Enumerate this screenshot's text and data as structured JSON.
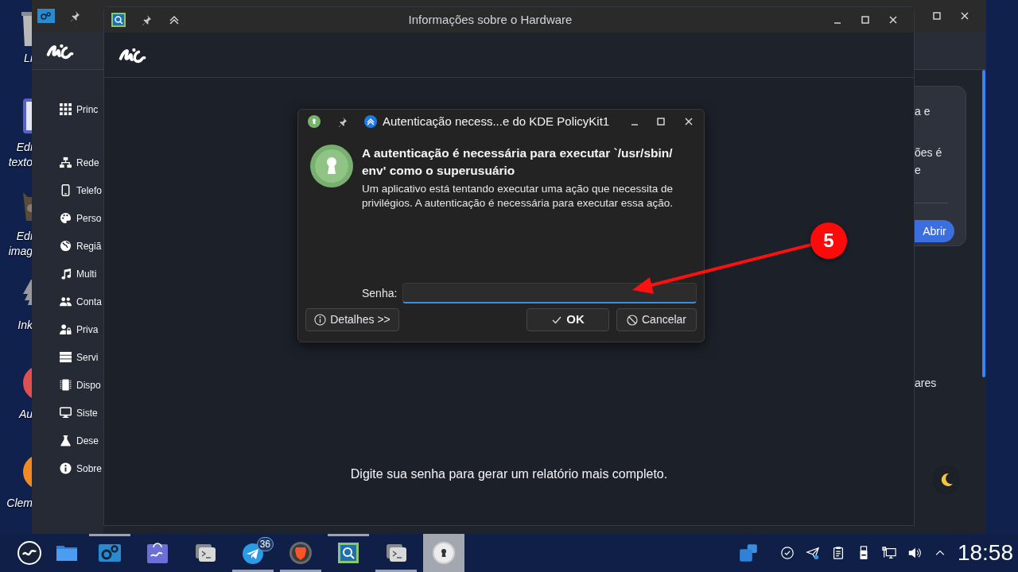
{
  "desktop_icons": [
    {
      "kind": "trash",
      "lines": [
        "Li"
      ]
    },
    {
      "kind": "document",
      "lines": [
        "Edi",
        "texto"
      ]
    },
    {
      "kind": "image-editor",
      "lines": [
        "Edi",
        "imag"
      ]
    },
    {
      "kind": "vector",
      "lines": [
        "Ink"
      ]
    },
    {
      "kind": "audio",
      "lines": [
        "Au"
      ]
    },
    {
      "kind": "music",
      "lines": [
        "Clem"
      ]
    }
  ],
  "settings_window": {
    "sidebar": [
      {
        "kind": "grid",
        "label": "Princ"
      },
      {
        "kind": "network",
        "label": "Rede"
      },
      {
        "kind": "phone",
        "label": "Telefo"
      },
      {
        "kind": "palette",
        "label": "Perso"
      },
      {
        "kind": "globe",
        "label": "Regiã"
      },
      {
        "kind": "music",
        "label": "Multi"
      },
      {
        "kind": "users",
        "label": "Conta"
      },
      {
        "kind": "privacy",
        "label": "Priva"
      },
      {
        "kind": "server",
        "label": "Servi"
      },
      {
        "kind": "chip",
        "label": "Dispo"
      },
      {
        "kind": "monitor",
        "label": "Siste"
      },
      {
        "kind": "flask",
        "label": "Dese"
      },
      {
        "kind": "info",
        "label": "Sobre"
      }
    ],
    "card_lines": [
      "a e",
      "ões é",
      "e"
    ],
    "card_button": "Abrir",
    "footer_text": "ares"
  },
  "hardware_window": {
    "title": "Informações sobre o Hardware",
    "message": "Digite sua senha para gerar um relatório mais completo."
  },
  "auth_dialog": {
    "title": "Autenticação necess...e do KDE PolicyKit1",
    "heading_lines": [
      "A autenticação é necessária para executar `/usr/sbin/",
      "env' como o superusuário"
    ],
    "description": "Um aplicativo está tentando executar uma ação que necessita de privilégios. A autenticação é necessária para executar essa ação.",
    "password_label": "Senha:",
    "details_button": "Detalhes >>",
    "ok_button": "OK",
    "cancel_button": "Cancelar"
  },
  "annotation": {
    "label": "5"
  },
  "taskbar": {
    "apps": [
      {
        "kind": "start",
        "line_above": false,
        "line_below": false,
        "selected": false
      },
      {
        "kind": "files",
        "line_above": false,
        "line_below": false,
        "selected": false
      },
      {
        "kind": "settings",
        "line_above": true,
        "line_below": false,
        "selected": false
      },
      {
        "kind": "store",
        "line_above": false,
        "line_below": false,
        "selected": false
      },
      {
        "kind": "terminal",
        "line_above": false,
        "line_below": false,
        "selected": false
      },
      {
        "kind": "telegram",
        "line_above": false,
        "line_below": true,
        "selected": false,
        "badge": "36"
      },
      {
        "kind": "browser",
        "line_above": false,
        "line_below": true,
        "selected": false
      },
      {
        "kind": "hardware",
        "line_above": true,
        "line_below": false,
        "selected": false
      },
      {
        "kind": "terminal",
        "line_above": false,
        "line_below": true,
        "selected": false
      },
      {
        "kind": "auth",
        "line_above": false,
        "line_below": false,
        "selected": true
      }
    ],
    "tray": [
      {
        "kind": "windows"
      },
      {
        "kind": "check"
      },
      {
        "kind": "send"
      },
      {
        "kind": "clipboard"
      },
      {
        "kind": "usb"
      },
      {
        "kind": "wired"
      },
      {
        "kind": "volume"
      },
      {
        "kind": "chevron"
      }
    ],
    "clock": "18:58"
  }
}
